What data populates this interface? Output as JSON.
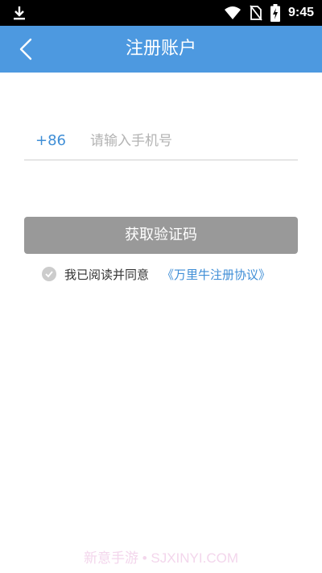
{
  "status_bar": {
    "time": "9:45",
    "icons": [
      "download-icon",
      "wifi-icon",
      "no-sim-icon",
      "battery-charging-icon"
    ]
  },
  "header": {
    "title": "注册账户",
    "back_icon": "chevron-left-icon"
  },
  "form": {
    "country_code": "+86",
    "phone_placeholder": "请输入手机号",
    "phone_value": "",
    "get_code_label": "获取验证码"
  },
  "agreement": {
    "checked": false,
    "text": "我已阅读并同意",
    "link": "《万里牛注册协议》"
  },
  "watermark": "新意手游 • SJXINYI.COM",
  "colors": {
    "nav_bar": "#4d99e0",
    "accent": "#3f8ed6",
    "button_disabled": "#999999"
  }
}
